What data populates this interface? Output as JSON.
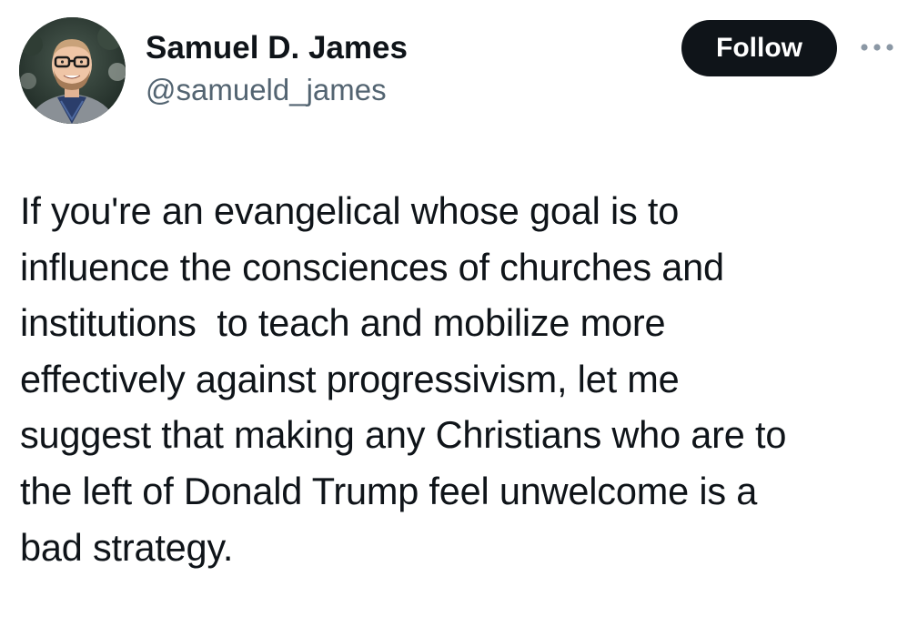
{
  "author": {
    "display_name": "Samuel D. James",
    "handle": "@samueld_james",
    "avatar_icon": "user-avatar-photo"
  },
  "actions": {
    "follow_label": "Follow",
    "more_icon": "more-horizontal-icon"
  },
  "tweet": {
    "lines": [
      "If you're an evangelical whose goal is to",
      "influence the consciences of churches and",
      "institutions  to teach and mobilize more",
      "effectively against progressivism, let me",
      "suggest that making any Christians who are to",
      "the left of Donald Trump feel unwelcome is a",
      "bad strategy."
    ]
  },
  "colors": {
    "text_primary": "#0f1419",
    "text_secondary": "#536471",
    "follow_bg": "#0f1419",
    "follow_text": "#ffffff",
    "icon_gray": "#8b98a5"
  }
}
